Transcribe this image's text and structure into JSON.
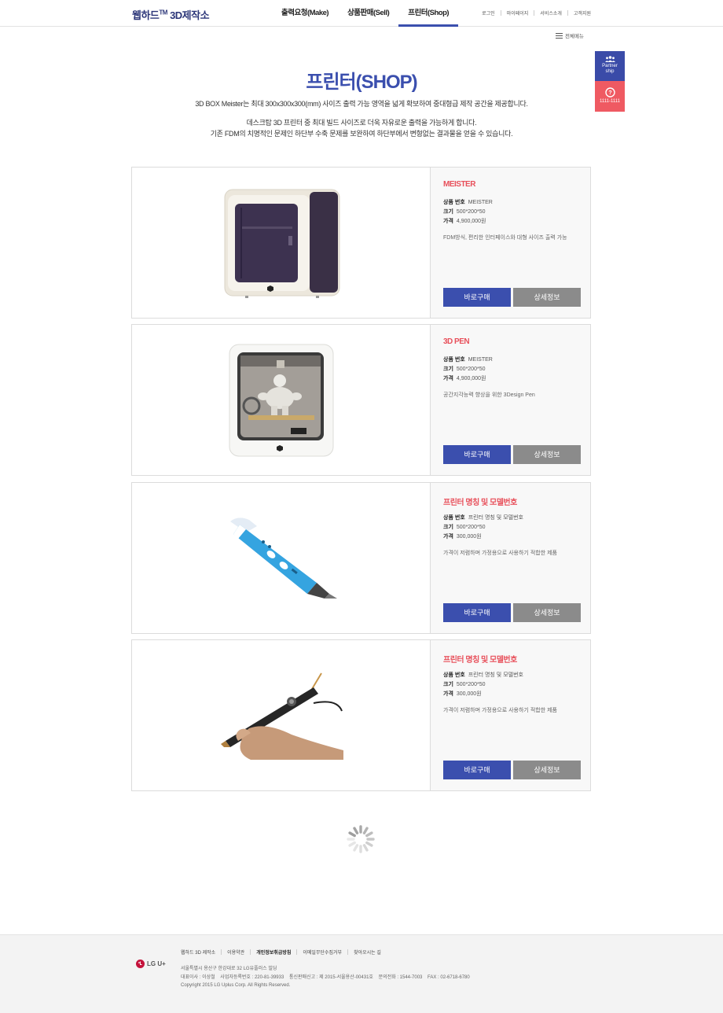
{
  "header": {
    "logo": "웹하드",
    "logo_tm": "TM",
    "logo_suffix": " 3D제작소",
    "nav": [
      {
        "label": "출력요청(Make)"
      },
      {
        "label": "상품판매(Sell)"
      },
      {
        "label": "프린터(Shop)"
      }
    ],
    "util": [
      "로그인",
      "마이페이지",
      "서비스소개",
      "고객지원"
    ],
    "all_menu": "전체메뉴"
  },
  "quick": {
    "partner": "Partner ship",
    "partner_line1": "Partner",
    "partner_line2": "ship",
    "cs_number": "1111-1111"
  },
  "page": {
    "title": "프린터(SHOP)",
    "desc1": "3D BOX Meister는 최대 300x300x300(mm) 사이즈 출력 가능 영역을 넓게 확보하여 중대형급 제작 공간을 제공합니다.",
    "desc2": "데스크탑 3D 프린터 중 최대 빌드 사이즈로 더욱 자유로운 출력을 가능하게 합니다.",
    "desc3": "기존 FDM의 치명적인 문제인 하단부 수축 문제를 보완하여 하단부에서 변형없는 결과물을 얻을 수 있습니다."
  },
  "labels": {
    "product_no": "상품 번호",
    "size": "크기",
    "price": "가격",
    "buy": "바로구매",
    "detail": "상세정보"
  },
  "products": [
    {
      "name": "MEISTER",
      "product_no": "MEISTER",
      "size": "500*200*50",
      "price": "4,900,000원",
      "desc": "FDM방식, 편리한 인터페이스와 대형 사이즈 출력 가능",
      "image": "printer-empty-image"
    },
    {
      "name": "3D PEN",
      "product_no": "MEISTER",
      "size": "500*200*50",
      "price": "4,900,000원",
      "desc": "공간지각능력 향상을 위한 3Design Pen",
      "image": "printer-with-figure-image"
    },
    {
      "name": "프린터 명칭 및 모델번호",
      "product_no": "프린터 명칭 및 모델번호",
      "size": "500*200*50",
      "price": "300,000원",
      "desc": "가격이 저렴하며 가정용으로 사용하기 적합한 제품",
      "image": "blue-3d-pen-image"
    },
    {
      "name": "프린터 명칭 및 모델번호",
      "product_no": "프린터 명칭 및 모델번호",
      "size": "500*200*50",
      "price": "300,000원",
      "desc": "가격이 저렴하며 가정용으로 사용하기 적합한 제품",
      "image": "hand-holding-3d-pen-image"
    }
  ],
  "footer": {
    "logo": "LG U+",
    "menu": [
      "웹하드 3D 제작소",
      "이용약관",
      "개인정보취급방침",
      "이메일무단수집거부",
      "찾아오시는 길"
    ],
    "address": "서울특별시 용산구 한강대로 32 LG유플러스 빌딩",
    "info": "대표이사 : 이상철    사업자등록번호 : 220-81-39933    통신판매신고 : 제 2015-서울용산-00431호    문의전화 : 1544-7003    FAX : 02-6718-6780",
    "copyright": "Copyright 2015 LG Uplus Corp. All Rights Reserved."
  },
  "colors": {
    "brand_blue": "#3b4fae",
    "accent_red": "#e8505b",
    "detail_gray": "#8b8b8b",
    "cs_red": "#ef5a62"
  }
}
